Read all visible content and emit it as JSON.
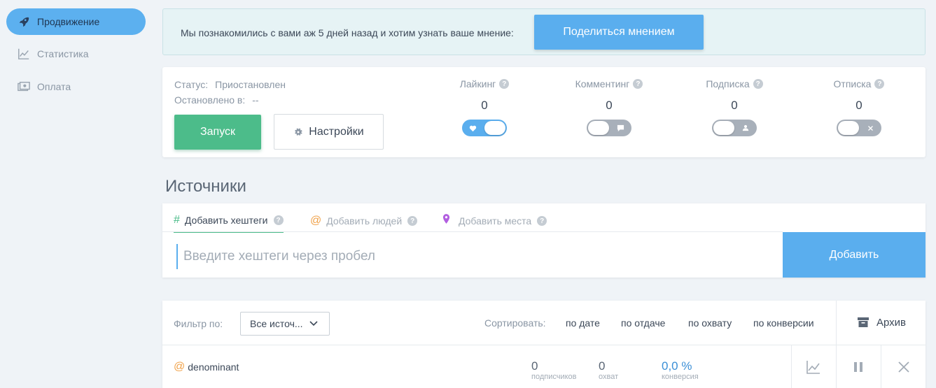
{
  "sidebar": {
    "items": [
      {
        "label": "Продвижение",
        "icon": "rocket-icon",
        "active": true
      },
      {
        "label": "Статистика",
        "icon": "chart-icon",
        "active": false
      },
      {
        "label": "Оплата",
        "icon": "money-icon",
        "active": false
      }
    ]
  },
  "banner": {
    "text": "Мы познакомились с вами аж 5 дней назад и хотим узнать ваше мнение:",
    "button_label": "Поделиться мнением"
  },
  "panel": {
    "status_label": "Статус:",
    "status_value": "Приостановлен",
    "stopped_label": "Остановлено в:",
    "stopped_value": "--",
    "start_label": "Запуск",
    "settings_label": "Настройки",
    "actions": [
      {
        "title": "Лайкинг",
        "count": "0",
        "enabled": true,
        "icon": "heart-icon"
      },
      {
        "title": "Комментинг",
        "count": "0",
        "enabled": false,
        "icon": "comment-icon"
      },
      {
        "title": "Подписка",
        "count": "0",
        "enabled": false,
        "icon": "user-icon"
      },
      {
        "title": "Отписка",
        "count": "0",
        "enabled": false,
        "icon": "close-icon"
      }
    ]
  },
  "sources": {
    "title": "Источники",
    "tabs": [
      {
        "symbol": "#",
        "label": "Добавить хештеги",
        "active": true,
        "color": "#4cbc8a"
      },
      {
        "symbol": "@",
        "label": "Добавить людей",
        "active": false,
        "color": "#f0a24a"
      },
      {
        "symbol": "place",
        "label": "Добавить места",
        "active": false,
        "color": "#b25ee0"
      }
    ],
    "input_placeholder": "Введите хештеги через пробел",
    "add_label": "Добавить"
  },
  "list": {
    "filter_label": "Фильтр по:",
    "filter_value": "Все источ...",
    "sort_label": "Сортировать:",
    "sort_options": [
      "по дате",
      "по отдаче",
      "по охвату",
      "по конверсии"
    ],
    "archive_label": "Архив",
    "rows": [
      {
        "name": "denominant",
        "subscribers": "0",
        "subscribers_label": "подписчиков",
        "reach": "0",
        "reach_label": "охват",
        "conversion": "0,0 %",
        "conversion_label": "конверсия"
      }
    ]
  },
  "colors": {
    "accent_blue": "#5aaeee",
    "accent_green": "#4cbc8a",
    "background": "#eff3f7"
  }
}
